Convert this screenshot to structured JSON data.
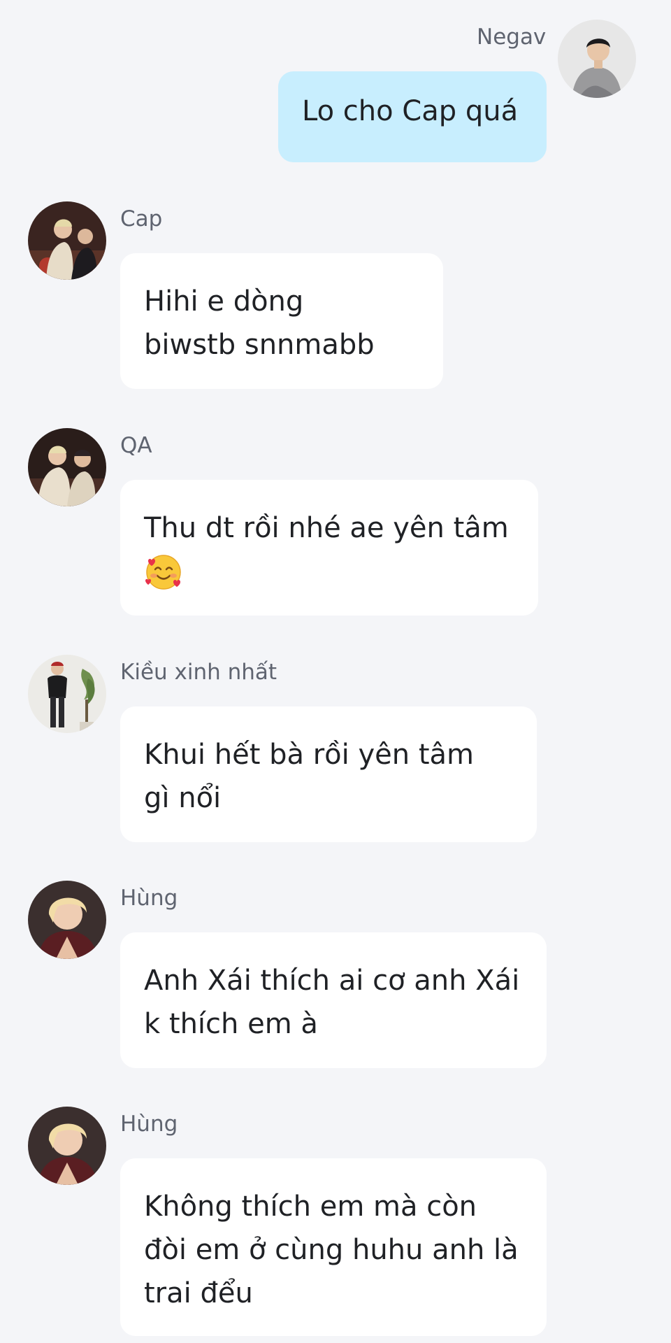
{
  "messages": [
    {
      "sender": "Negav",
      "outgoing": true,
      "lines": [
        "Lo cho Cap quá"
      ],
      "avatar": "man-grey-sweater-avatar"
    },
    {
      "sender": "Cap",
      "outgoing": false,
      "lines": [
        "Hihi e dòng",
        "biwstb snnmabb"
      ],
      "avatar": "two-people-couch-avatar"
    },
    {
      "sender": "QA",
      "outgoing": false,
      "lines": [
        "Thu dt rồi nhé ae yên tâm"
      ],
      "emoji": "smiling-face-with-hearts-emoji",
      "avatar": "two-people-couch-avatar"
    },
    {
      "sender": "Kiều xinh nhất",
      "outgoing": false,
      "lines": [
        "Khui hết bà rồi yên tâm",
        "gì nổi"
      ],
      "avatar": "person-standing-plant-avatar"
    },
    {
      "sender": "Hùng",
      "outgoing": false,
      "lines": [
        "Anh Xái thích ai cơ anh Xái",
        "k thích em à"
      ],
      "avatar": "blond-person-avatar"
    },
    {
      "sender": "Hùng",
      "outgoing": false,
      "lines": [
        "Không thích em mà còn",
        "đòi em ở cùng huhu anh là",
        "trai đểu"
      ],
      "avatar": "blond-person-avatar"
    }
  ],
  "colors": {
    "background": "#f4f5f8",
    "incoming_bubble": "#ffffff",
    "outgoing_bubble": "#c8eefe",
    "sender_text": "#5f6470",
    "message_text": "#1f2125"
  }
}
